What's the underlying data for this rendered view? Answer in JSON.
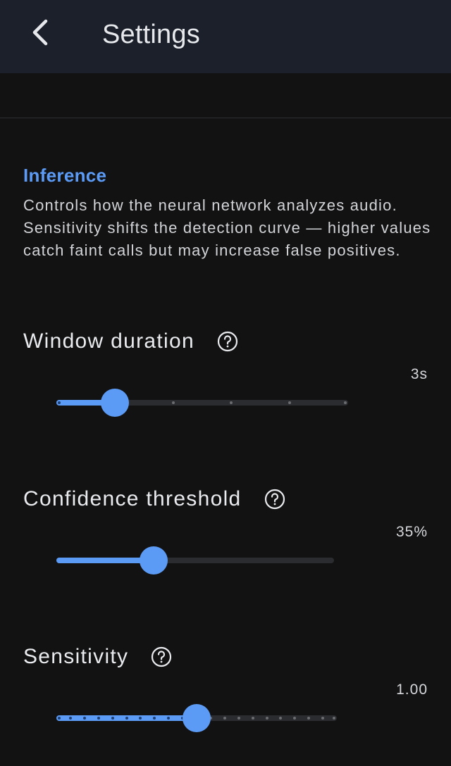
{
  "header": {
    "title": "Settings",
    "back_icon": "chevron-left-icon"
  },
  "section": {
    "title": "Inference",
    "description": "Controls how the neural network analyzes audio. Sensitivity shifts the detection curve — higher values catch faint calls but may increase false positives."
  },
  "settings": [
    {
      "label": "Window duration",
      "value_text": "3s",
      "steps": 5,
      "position": 1
    },
    {
      "label": "Confidence threshold",
      "value_text": "35%",
      "fraction": 0.35
    },
    {
      "label": "Sensitivity",
      "value_text": "1.00",
      "steps": 20,
      "position": 10
    }
  ],
  "colors": {
    "accent": "#5b9bf5",
    "background": "#121212",
    "topbar": "#1b202a",
    "track": "#2b2c2f"
  }
}
